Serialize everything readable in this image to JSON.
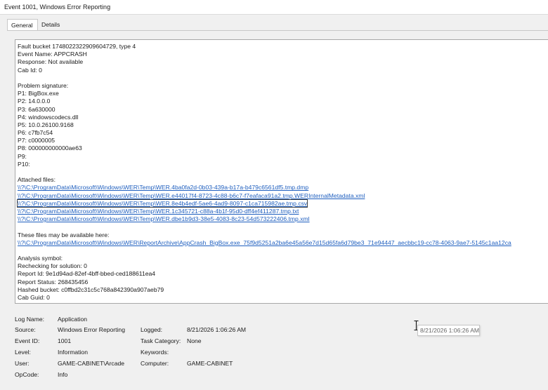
{
  "window": {
    "title": "Event 1001, Windows Error Reporting"
  },
  "tabs": [
    {
      "label": "General",
      "active": true
    },
    {
      "label": "Details",
      "active": false
    }
  ],
  "description": {
    "header_lines": [
      "Fault bucket 1748022322909604729, type 4",
      "Event Name: APPCRASH",
      "Response: Not available",
      "Cab Id: 0"
    ],
    "signature_heading": "Problem signature:",
    "signature_lines": [
      "P1: BigBox.exe",
      "P2: 14.0.0.0",
      "P3: 6a630000",
      "P4: windowscodecs.dll",
      "P5: 10.0.26100.9168",
      "P6: c7fb7c54",
      "P7: c0000005",
      "P8: 000000000000ae63",
      "P9:",
      "P10:"
    ],
    "attached_heading": "Attached files:",
    "attached_files": [
      "\\\\?\\C:\\ProgramData\\Microsoft\\Windows\\WER\\Temp\\WER.4ba0fa2d-0b03-439a-b17a-b479c6561df5.tmp.dmp",
      "\\\\?\\C:\\ProgramData\\Microsoft\\Windows\\WER\\Temp\\WER.e44017f4-8723-4c88-b6c7-f7eafaca91a2.tmp.WERInternalMetadata.xml",
      "\\\\?\\C:\\ProgramData\\Microsoft\\Windows\\WER\\Temp\\WER.8e4b4edf-5ae6-4ad9-8097-c1ca715982ae.tmp.csv",
      "\\\\?\\C:\\ProgramData\\Microsoft\\Windows\\WER\\Temp\\WER.1c345721-c88a-4b1f-95d0-dff4ef411287.tmp.txt",
      "\\\\?\\C:\\ProgramData\\Microsoft\\Windows\\WER\\Temp\\WER.dbe1b9d3-38e5-4083-8c23-54d573222406.tmp.xml"
    ],
    "available_heading": "These files may be available here:",
    "archive_path": "\\\\?\\C:\\ProgramData\\Microsoft\\Windows\\WER\\ReportArchive\\AppCrash_BigBox.exe_75f9d5251a2ba6e45a56e7d15d65fa6d79be3_71e94447_aecbbc19-cc78-4063-9ae7-5145c1aa12ca",
    "analysis_heading": "Analysis symbol:",
    "analysis_lines": [
      "Rechecking for solution: 0",
      "Report Id: 9e1d94ad-82ef-4bff-bbed-ced188611ea4",
      "Report Status: 268435456",
      "Hashed bucket: c0ffbd2c31c5c768a842390a907aeb79",
      "Cab Guid: 0"
    ]
  },
  "properties": {
    "log_name": {
      "label": "Log Name:",
      "value": "Application"
    },
    "source": {
      "label": "Source:",
      "value": "Windows Error Reporting"
    },
    "event_id": {
      "label": "Event ID:",
      "value": "1001"
    },
    "level": {
      "label": "Level:",
      "value": "Information"
    },
    "user": {
      "label": "User:",
      "value": "GAME-CABINET\\Arcade"
    },
    "opcode": {
      "label": "OpCode:",
      "value": "Info"
    },
    "logged": {
      "label": "Logged:",
      "value": "8/21/2026 1:06:26 AM"
    },
    "task_category": {
      "label": "Task Category:",
      "value": "None"
    },
    "keywords": {
      "label": "Keywords:",
      "value": ""
    },
    "computer": {
      "label": "Computer:",
      "value": "GAME-CABINET"
    }
  },
  "tooltip": {
    "text": "8/21/2026 1:06:26 AM"
  },
  "colors": {
    "link": "#1f5fbf",
    "background": "#f0f0f0",
    "panel": "#ffffff",
    "border": "#a8a8a8"
  },
  "cursor": {
    "icon": "text-ibeam-cursor-icon"
  }
}
